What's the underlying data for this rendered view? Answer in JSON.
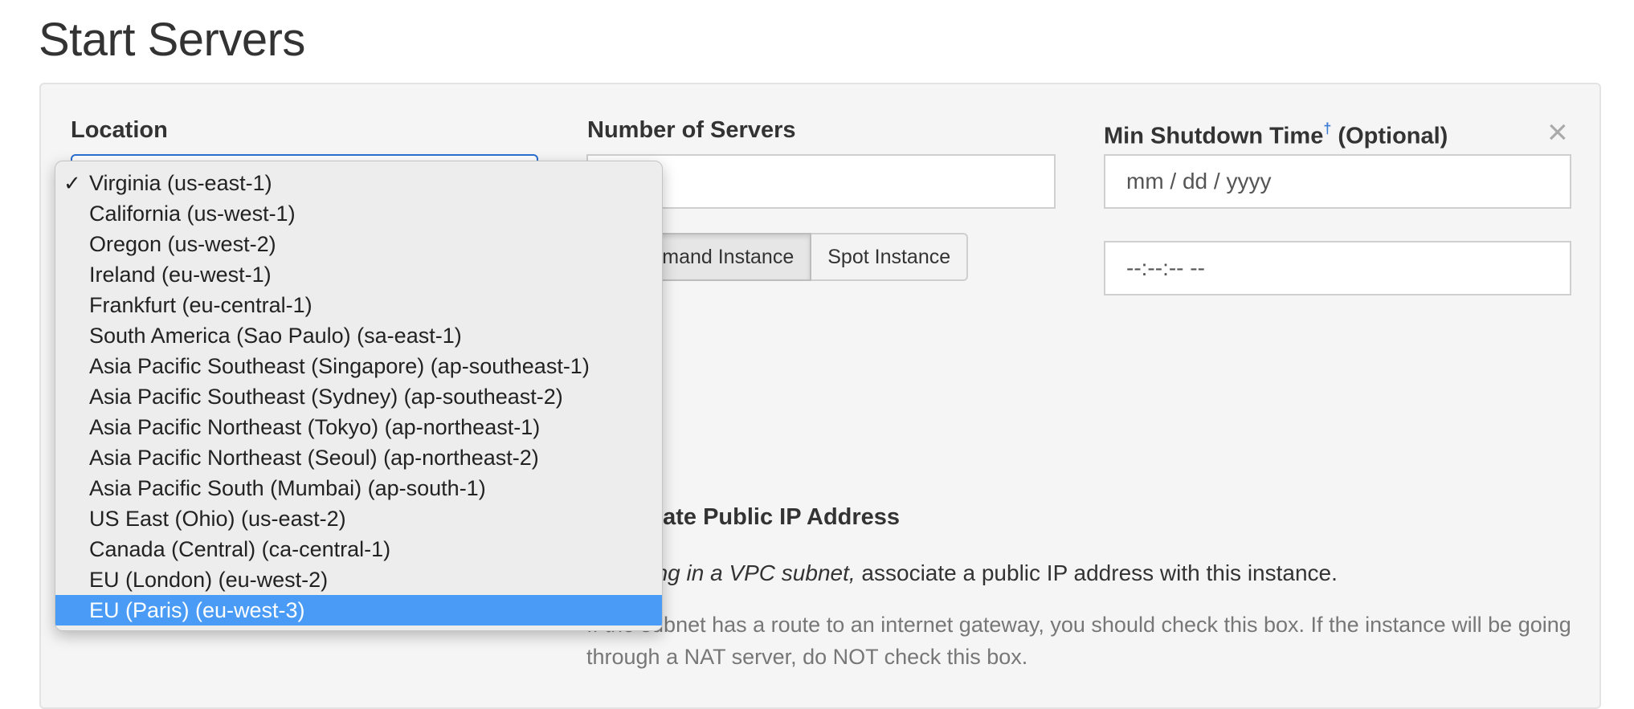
{
  "page": {
    "title": "Start Servers"
  },
  "form": {
    "location_label": "Location",
    "servers_label": "Number of Servers",
    "shutdown_label": "Min Shutdown Time",
    "shutdown_dagger": "†",
    "shutdown_optional": "(Optional)",
    "date_placeholder": "mm / dd / yyyy",
    "time_placeholder": "--:--:-- --",
    "instance_buttons": [
      "On Demand Instance",
      "Spot Instance"
    ],
    "ip_label": "Associate Public IP Address",
    "ip_desc_italic": "If running in a VPC subnet,",
    "ip_desc_rest": " associate a public IP address with this instance.",
    "ip_help": "If the subnet has a route to an internet gateway, you should check this box. If the instance will be going through a NAT server, do NOT check this box."
  },
  "dropdown": {
    "checkmark": "✓",
    "checked_index": 0,
    "highlighted_index": 14,
    "options": [
      "Virginia (us-east-1)",
      "California (us-west-1)",
      "Oregon (us-west-2)",
      "Ireland (eu-west-1)",
      "Frankfurt (eu-central-1)",
      "South America (Sao Paulo) (sa-east-1)",
      "Asia Pacific Southeast (Singapore) (ap-southeast-1)",
      "Asia Pacific Southeast (Sydney) (ap-southeast-2)",
      "Asia Pacific Northeast (Tokyo) (ap-northeast-1)",
      "Asia Pacific Northeast (Seoul) (ap-northeast-2)",
      "Asia Pacific South (Mumbai) (ap-south-1)",
      "US East (Ohio) (us-east-2)",
      "Canada (Central) (ca-central-1)",
      "EU (London) (eu-west-2)",
      "EU (Paris) (eu-west-3)"
    ]
  },
  "icons": {
    "close": "close-icon",
    "check": "checkmark-icon"
  },
  "colors": {
    "accent": "#4a9bf5",
    "link": "#3a7bd5"
  }
}
